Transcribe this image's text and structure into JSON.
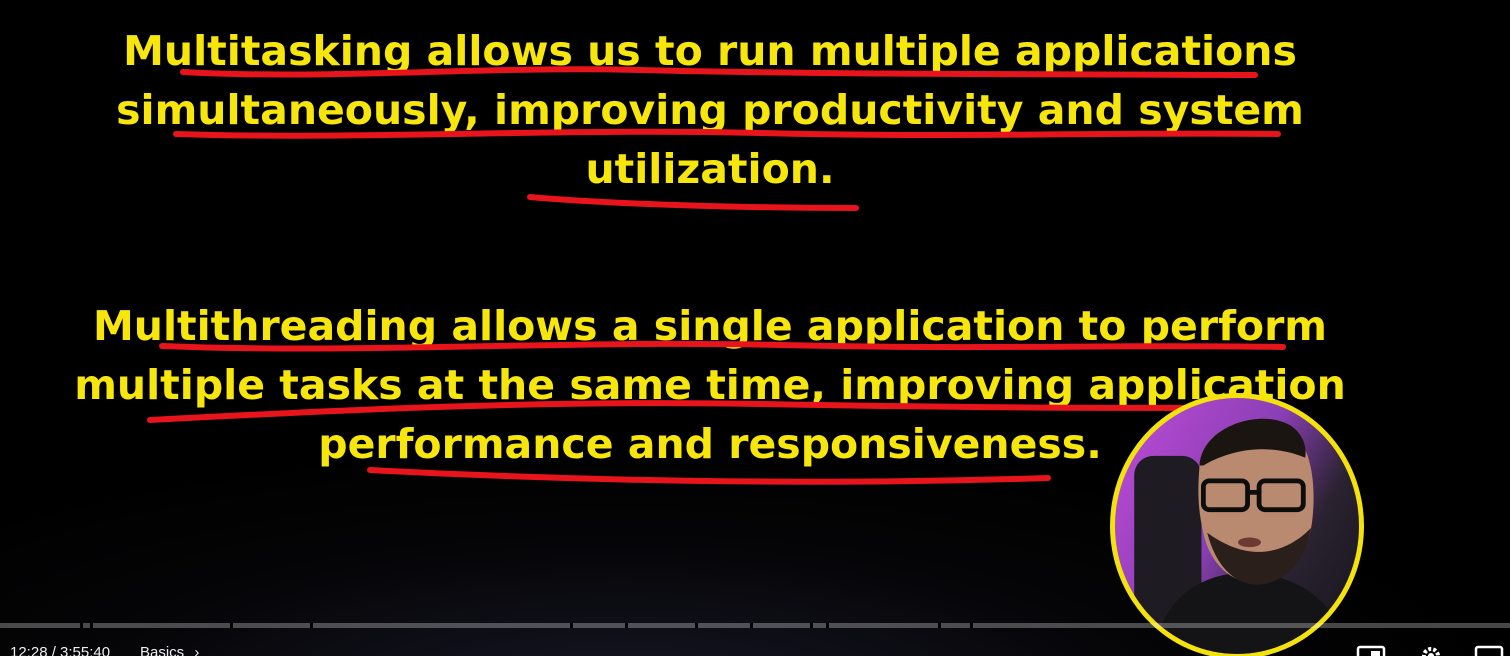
{
  "slide": {
    "paragraphs": [
      {
        "lines": [
          "Multitasking allows us to run multiple applications",
          "simultaneously, improving productivity and system",
          "utilization."
        ]
      },
      {
        "lines": [
          "Multithreading allows a single application to perform",
          "multiple tasks at the same time, improving application",
          "performance and responsiveness."
        ]
      }
    ],
    "text_color": "#f7e60c",
    "annotation_color": "#e8141c"
  },
  "webcam": {
    "border_color": "#f4e20c"
  },
  "player": {
    "time_display": "12:28 / 3:55:40",
    "chapter": "Basics",
    "icons": [
      "chevron-right-icon",
      "miniplayer-icon",
      "settings-icon",
      "theater-mode-icon"
    ]
  }
}
